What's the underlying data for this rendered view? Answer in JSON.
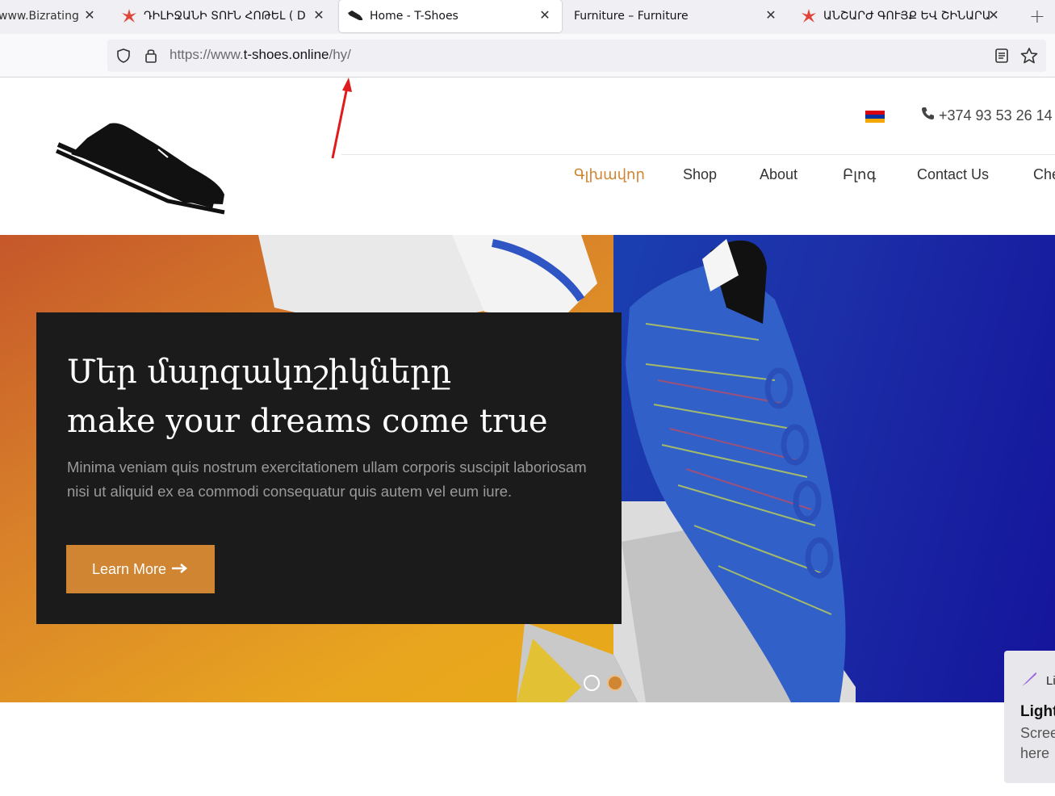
{
  "browser": {
    "tabs": [
      {
        "title": "www.Bizratings.",
        "icon": "globe-icon",
        "active": false
      },
      {
        "title": "ԴԻԼԻՋԱՆԻ ՏՈՒՆ ՀՈԹԵԼ ( DI",
        "icon": "red-star-icon",
        "active": false
      },
      {
        "title": "Home - T-Shoes",
        "icon": "shoe-icon",
        "active": true
      },
      {
        "title": "Furniture – Furniture",
        "icon": "",
        "active": false
      },
      {
        "title": "ԱՆՇԱՐԺ ԳՈՒՅՔ ԵՎ ՇԻՆԱՐԱ",
        "icon": "red-star-icon",
        "active": false
      }
    ],
    "new_tab_label": "+",
    "close_label": "✕",
    "url_prefix": "https://www.",
    "url_domain": "t-shoes.online",
    "url_path": "/hy/"
  },
  "header": {
    "phone": "+374 93 53 26 14",
    "language_flag": "armenian-flag",
    "flag_colors": [
      "#d90012",
      "#0033a0",
      "#f2a800"
    ]
  },
  "nav": {
    "items": [
      {
        "label": "Գլխավոր",
        "active": true
      },
      {
        "label": "Shop",
        "active": false
      },
      {
        "label": "About",
        "active": false
      },
      {
        "label": "Բլոգ",
        "active": false
      },
      {
        "label": "Contact Us",
        "active": false
      },
      {
        "label": "Che",
        "active": false
      }
    ]
  },
  "hero": {
    "title_line1": "Մեր մարզակոշիկները",
    "title_line2": "make your dreams come true",
    "text": "Minima veniam quis nostrum exercitationem ullam corporis suscipit laboriosam nisi ut aliquid ex ea commodi consequatur quis autem vel eum iure.",
    "button_label": "Learn More",
    "button_icon": "arrow-right-icon",
    "slides_total": 2,
    "slide_active": 2
  },
  "lightshot_panel": {
    "top_label": "Lig",
    "heading": "Light",
    "body_line1": "Scree",
    "body_line2": "here"
  },
  "colors": {
    "accent": "#cf8531",
    "card_bg": "#1b1b1b",
    "annotation_arrow": "#e01b1b"
  }
}
